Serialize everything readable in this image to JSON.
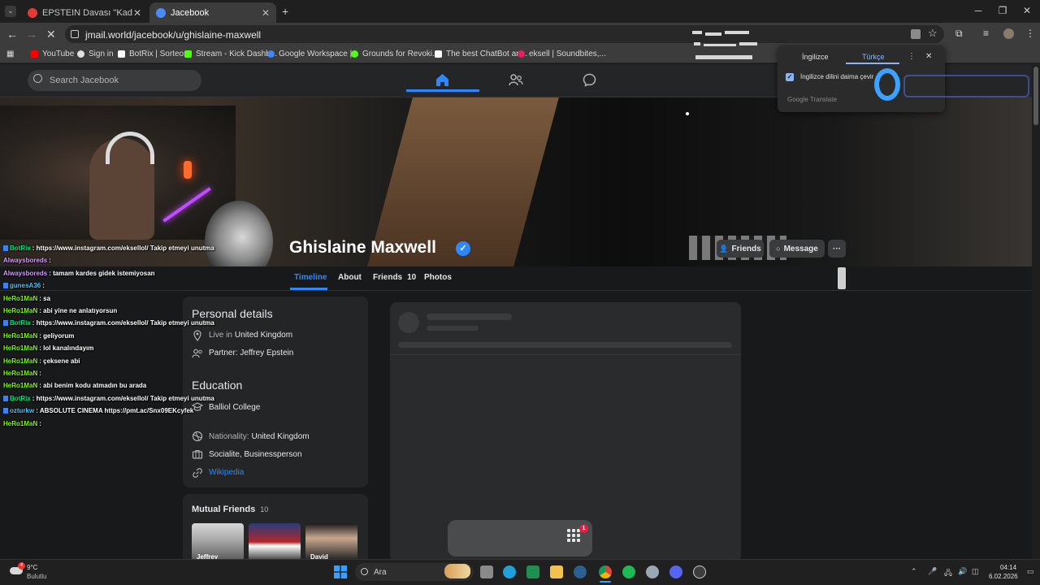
{
  "browser": {
    "tabs": [
      {
        "title": "EPSTEIN Davası \"Kadın ve Çocu",
        "icon_color": "#e53935"
      },
      {
        "title": "Jacebook",
        "icon_color": "#4c8bf5"
      }
    ],
    "new_tab": "+",
    "url": "jmail.world/jacebook/u/ghislaine-maxwell",
    "bookmarks": [
      {
        "label": "YouTube",
        "color": "#ff0000"
      },
      {
        "label": "Sign in",
        "color": "#e0e0e0"
      },
      {
        "label": "BotRix | Sorteos",
        "color": "#ffffff"
      },
      {
        "label": "Stream - Kick Dashb...",
        "color": "#53fc18"
      },
      {
        "label": "Google Workspace |...",
        "color": "#4285f4"
      },
      {
        "label": "Grounds for Revoki...",
        "color": "#53fc18"
      },
      {
        "label": "The best ChatBot an...",
        "color": "#ffffff"
      },
      {
        "label": "eksell | Soundbites,...",
        "color": "#e91e63"
      }
    ]
  },
  "translate": {
    "lang_source": "İngilizce",
    "lang_target": "Türkçe",
    "always_translate": "İngilizce dilini daima çevir",
    "powered_by": "Google Translate"
  },
  "site": {
    "search_placeholder": "Search Jacebook",
    "accent": "#2d88ff"
  },
  "profile": {
    "name": "Ghislaine Maxwell",
    "verified_mark": "✓",
    "friends_button": "Friends",
    "message_button": "Message",
    "more_button": "···",
    "tabs": [
      {
        "label": "Timeline"
      },
      {
        "label": "About"
      },
      {
        "label": "Friends",
        "count": "10"
      },
      {
        "label": "Photos"
      }
    ]
  },
  "intro": {
    "personal_title": "Personal details",
    "live_prefix": "Live in",
    "live_value": "United Kingdom",
    "partner": "Partner: Jeffrey Epstein",
    "education_title": "Education",
    "school": "Balliol College",
    "nationality_prefix": "Nationality:",
    "nationality_value": "United Kingdom",
    "occupation": "Socialite, Businessperson",
    "wiki_link": "Wikipedia"
  },
  "mutual": {
    "title": "Mutual Friends",
    "count": "10",
    "friends": [
      {
        "name": "Jeffrey"
      },
      {
        "name": ""
      },
      {
        "name": "David"
      }
    ]
  },
  "chat": [
    {
      "user": "BotRix",
      "color": "#00e676",
      "badge": true,
      "text": ": https://www.instagram.com/eksellol/ Takip etmeyi unutma"
    },
    {
      "user": "Alwaysboreds",
      "color": "#d59bff",
      "badge": false,
      "text": ":"
    },
    {
      "user": "Alwaysboreds",
      "color": "#d59bff",
      "badge": false,
      "text": ": tamam kardes gidek istemiyosan"
    },
    {
      "user": "gunesA36",
      "color": "#4fc3f7",
      "badge": true,
      "text": ":"
    },
    {
      "user": "HeRo1MaN",
      "color": "#76ff03",
      "badge": false,
      "text": ": sa"
    },
    {
      "user": "HeRo1MaN",
      "color": "#76ff03",
      "badge": false,
      "text": ": abi yine ne anlatıyorsun"
    },
    {
      "user": "BotRix",
      "color": "#00e676",
      "badge": true,
      "text": ": https://www.instagram.com/eksellol/ Takip etmeyi unutma"
    },
    {
      "user": "HeRo1MaN",
      "color": "#76ff03",
      "badge": false,
      "text": ": geliyorum"
    },
    {
      "user": "HeRo1MaN",
      "color": "#76ff03",
      "badge": false,
      "text": ": lol kanalındayım"
    },
    {
      "user": "HeRo1MaN",
      "color": "#76ff03",
      "badge": false,
      "text": ": çeksene abi"
    },
    {
      "user": "HeRo1MaN",
      "color": "#76ff03",
      "badge": false,
      "text": ":"
    },
    {
      "user": "HeRo1MaN",
      "color": "#76ff03",
      "badge": false,
      "text": ": abi benim kodu atmadın bu arada"
    },
    {
      "user": "BotRix",
      "color": "#00e676",
      "badge": true,
      "text": ": https://www.instagram.com/eksellol/ Takip etmeyi unutma"
    },
    {
      "user": "ozturkw",
      "color": "#4fc3f7",
      "badge": true,
      "text": ": ABSOLUTE CINEMA https://pmt.ac/Snx09EKcyfek"
    },
    {
      "user": "HeRo1MaN",
      "color": "#76ff03",
      "badge": false,
      "text": ":"
    }
  ],
  "dock": {
    "badge": "1"
  },
  "taskbar": {
    "weather_temp": "9°C",
    "weather_desc": "Bulutlu",
    "weather_badge": "4",
    "search_label": "Ara",
    "time": "04:14",
    "date": "6.02.2026"
  }
}
